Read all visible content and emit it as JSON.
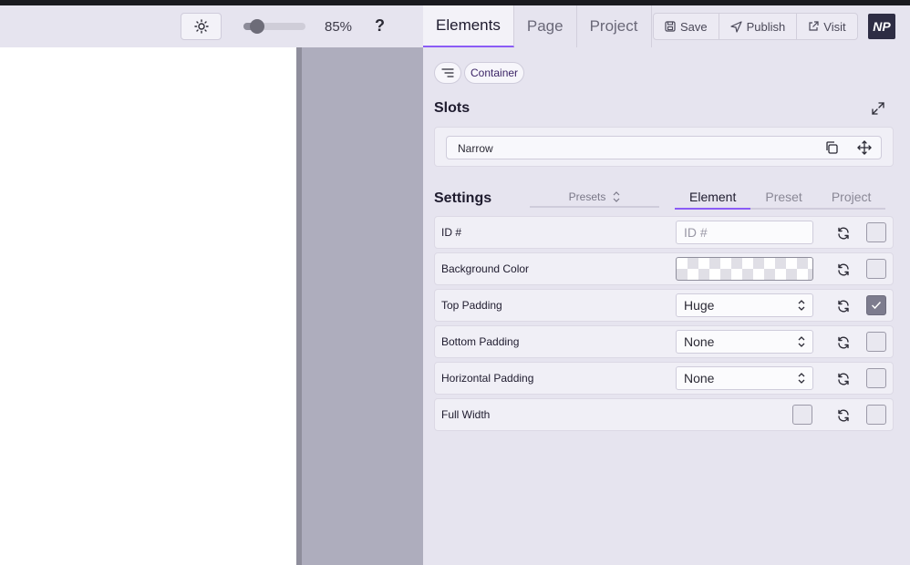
{
  "toolbar": {
    "zoom_percent": 85,
    "zoom_label": "85%",
    "help_label": "?"
  },
  "panel": {
    "tabs": [
      {
        "label": "Elements",
        "active": true
      },
      {
        "label": "Page",
        "active": false
      },
      {
        "label": "Project",
        "active": false
      }
    ],
    "actions": [
      {
        "label": "Save",
        "icon": "save-icon"
      },
      {
        "label": "Publish",
        "icon": "send-icon"
      },
      {
        "label": "Visit",
        "icon": "external-link-icon"
      }
    ],
    "logo_text": "NP"
  },
  "breadcrumb": {
    "current": "Container"
  },
  "slots": {
    "title": "Slots",
    "slot_label": "Narrow"
  },
  "settings": {
    "title": "Settings",
    "presets_label": "Presets",
    "tabs": [
      {
        "label": "Element",
        "active": true
      },
      {
        "label": "Preset",
        "active": false
      },
      {
        "label": "Project",
        "active": false
      }
    ],
    "rows": [
      {
        "label": "ID #",
        "type": "text",
        "placeholder": "ID #",
        "value": "",
        "checked": false
      },
      {
        "label": "Background Color",
        "type": "color",
        "value": "transparent",
        "checked": false
      },
      {
        "label": "Top Padding",
        "type": "select",
        "value": "Huge",
        "checked": true
      },
      {
        "label": "Bottom Padding",
        "type": "select",
        "value": "None",
        "checked": false
      },
      {
        "label": "Horizontal Padding",
        "type": "select",
        "value": "None",
        "checked": false
      },
      {
        "label": "Full Width",
        "type": "checkbox",
        "value": false,
        "checked": false
      }
    ]
  },
  "colors": {
    "accent": "#8b5cf6",
    "panel_bg": "#e6e4ef",
    "canvas_gray": "#aeadbd"
  }
}
